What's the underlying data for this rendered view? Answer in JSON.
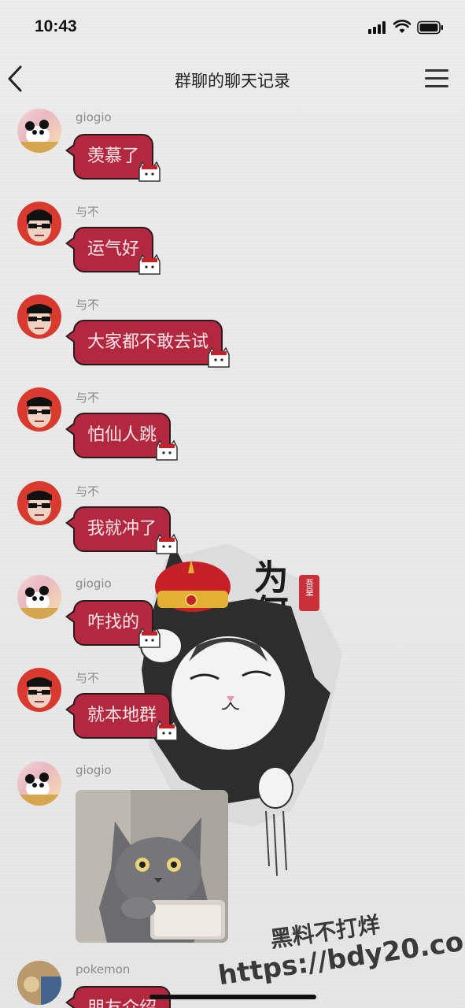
{
  "status_bar": {
    "time": "10:43"
  },
  "nav": {
    "title": "群聊的聊天记录"
  },
  "messages": [
    {
      "sender": "giogio",
      "avatar": "panda-avatar",
      "text": "羡慕了"
    },
    {
      "sender": "与不",
      "avatar": "guy-avatar",
      "text": "运气好"
    },
    {
      "sender": "与不",
      "avatar": "guy-avatar",
      "text": "大家都不敢去试"
    },
    {
      "sender": "与不",
      "avatar": "guy-avatar",
      "text": "怕仙人跳"
    },
    {
      "sender": "与不",
      "avatar": "guy-avatar",
      "text": "我就冲了"
    },
    {
      "sender": "giogio",
      "avatar": "panda-avatar",
      "text": "咋找的"
    },
    {
      "sender": "与不",
      "avatar": "guy-avatar",
      "text": "就本地群"
    },
    {
      "sender": "giogio",
      "avatar": "panda-avatar",
      "image": "cat-photo"
    },
    {
      "sender": "pokemon",
      "avatar": "pokemon-avatar",
      "text": "朋友介绍"
    }
  ],
  "background_art": {
    "calligraphy": "为何不跪",
    "seal": "吾皇"
  },
  "watermark": {
    "line1": "黑料不打烊",
    "line2": "https://bdy20.co"
  },
  "colors": {
    "bubble": "#b2293f",
    "bubble_border": "#2a1a1c",
    "bubble_text": "#ffe6ea"
  }
}
